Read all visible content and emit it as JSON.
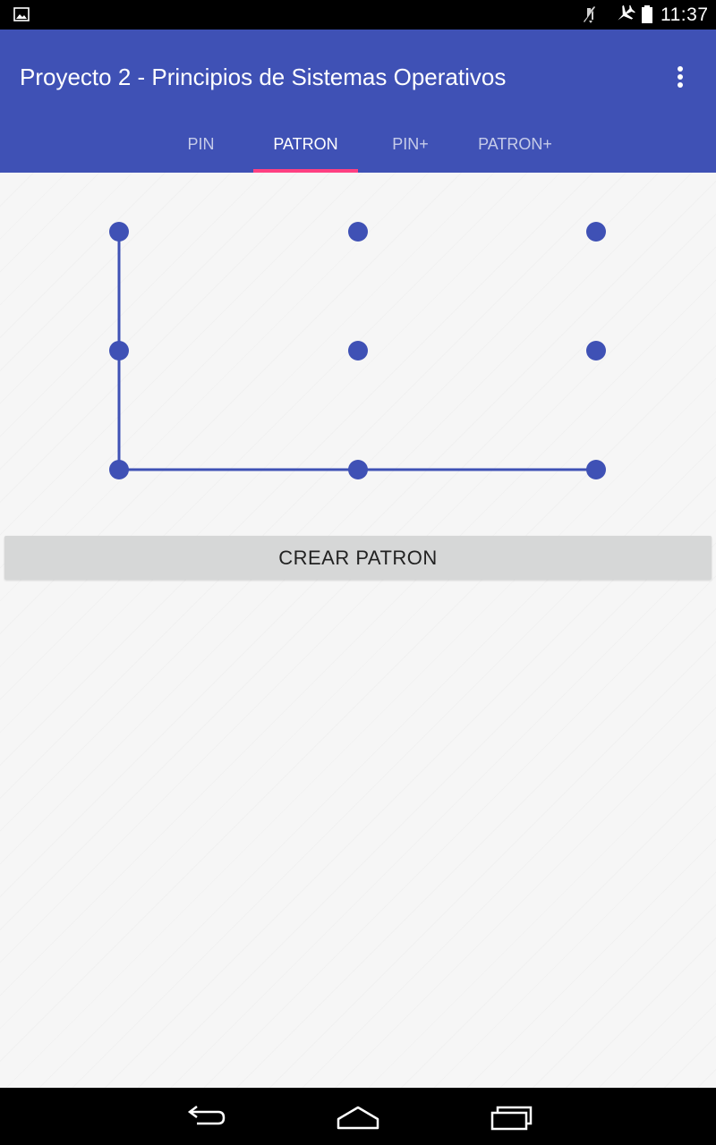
{
  "status_bar": {
    "time": "11:37",
    "icons": [
      "gallery-icon",
      "mute-icon",
      "airplane-icon",
      "battery-icon"
    ]
  },
  "app_bar": {
    "title": "Proyecto 2 - Principios de Sistemas Operativos",
    "menu_icon": "overflow-menu-icon",
    "tabs": [
      {
        "label": "PIN",
        "active": false
      },
      {
        "label": "PATRON",
        "active": true
      },
      {
        "label": "PIN+",
        "active": false
      },
      {
        "label": "PATRON+",
        "active": false
      }
    ]
  },
  "pattern": {
    "grid_rows": 3,
    "grid_cols": 3,
    "selected_sequence": [
      1,
      4,
      7,
      8,
      9
    ],
    "color": "#3f51b5"
  },
  "actions": {
    "create_label": "CREAR PATRON"
  },
  "nav_bar": {
    "icons": [
      "back-icon",
      "home-icon",
      "recents-icon"
    ]
  },
  "colors": {
    "primary": "#3f51b5",
    "accent": "#ff4081",
    "background": "#f6f6f6",
    "button": "#d6d7d7"
  }
}
